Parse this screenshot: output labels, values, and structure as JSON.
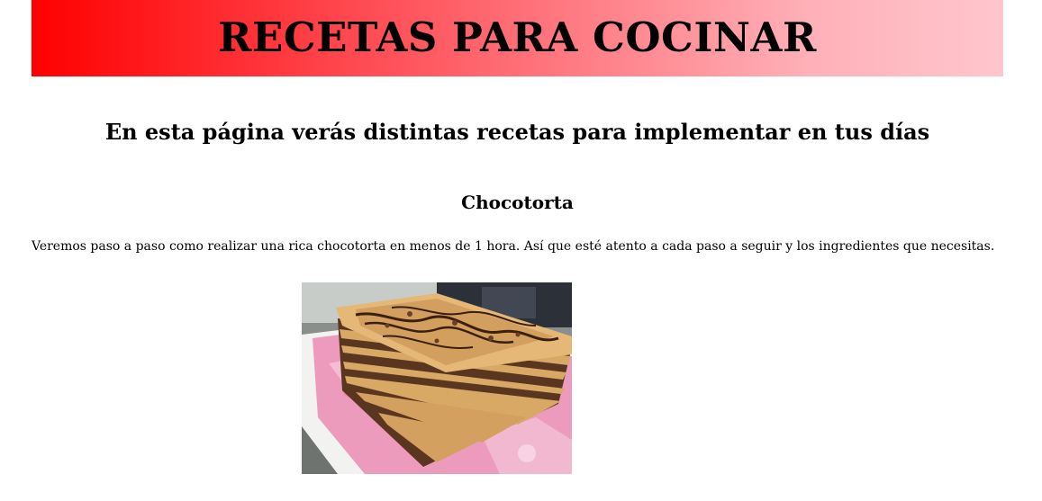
{
  "header": {
    "title": "RECETAS PARA COCINAR"
  },
  "main": {
    "subtitle": "En esta página verás distintas recetas para implementar en tus días",
    "recipe": {
      "title": "Chocotorta",
      "description": "Veremos paso a paso como realizar una rica chocotorta en menos de 1 hora. Así que esté atento a cada paso a seguir y los ingredientes que necesitas.",
      "image_alt": "chocotorta"
    }
  },
  "colors": {
    "banner_start": "#ff0000",
    "banner_end": "#ffc6cd"
  }
}
